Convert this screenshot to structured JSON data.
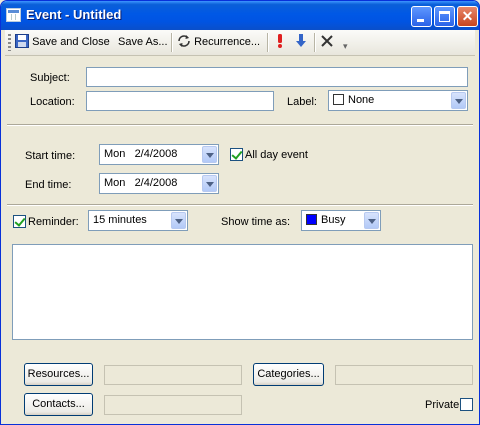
{
  "window": {
    "title": "Event - Untitled"
  },
  "toolbar": {
    "save_close": "Save and Close",
    "save_as": "Save As...",
    "recurrence": "Recurrence..."
  },
  "form": {
    "subject_label": "Subject:",
    "subject_value": "",
    "location_label": "Location:",
    "location_value": "",
    "label_label": "Label:",
    "label_value": "None",
    "label_color": "#ffffff",
    "start_label": "Start time:",
    "start_value": "Mon   2/4/2008",
    "all_day_label": "All day event",
    "all_day_checked": true,
    "end_label": "End time:",
    "end_value": "Mon   2/4/2008",
    "reminder_label": "Reminder:",
    "reminder_checked": true,
    "reminder_value": "15 minutes",
    "show_as_label": "Show time as:",
    "show_as_value": "Busy",
    "show_as_color": "#0000ff",
    "notes_value": ""
  },
  "footer": {
    "resources_button": "Resources...",
    "categories_button": "Categories...",
    "contacts_button": "Contacts...",
    "private_label": "Private"
  },
  "colors": {
    "titlebar": "#0054e3",
    "window_bg": "#ece9d8"
  }
}
